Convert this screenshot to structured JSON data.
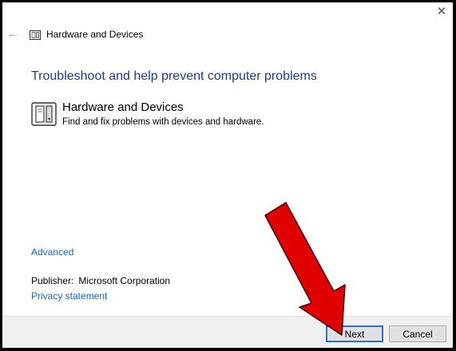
{
  "window": {
    "title": "Hardware and Devices",
    "close_glyph": "✕",
    "back_glyph": "←"
  },
  "main": {
    "headline": "Troubleshoot and help prevent computer problems",
    "item": {
      "title": "Hardware and Devices",
      "description": "Find and fix problems with devices and hardware.",
      "icon": "hardware-device-icon"
    },
    "advanced_link": "Advanced",
    "publisher_label": "Publisher:",
    "publisher_value": "Microsoft Corporation",
    "privacy_link": "Privacy statement"
  },
  "footer": {
    "next_label": "Next",
    "cancel_label": "Cancel"
  },
  "colors": {
    "headline": "#1a3e8c",
    "link": "#1764c7",
    "arrow": "#e00000",
    "footer_bg": "#f0f0f0"
  }
}
